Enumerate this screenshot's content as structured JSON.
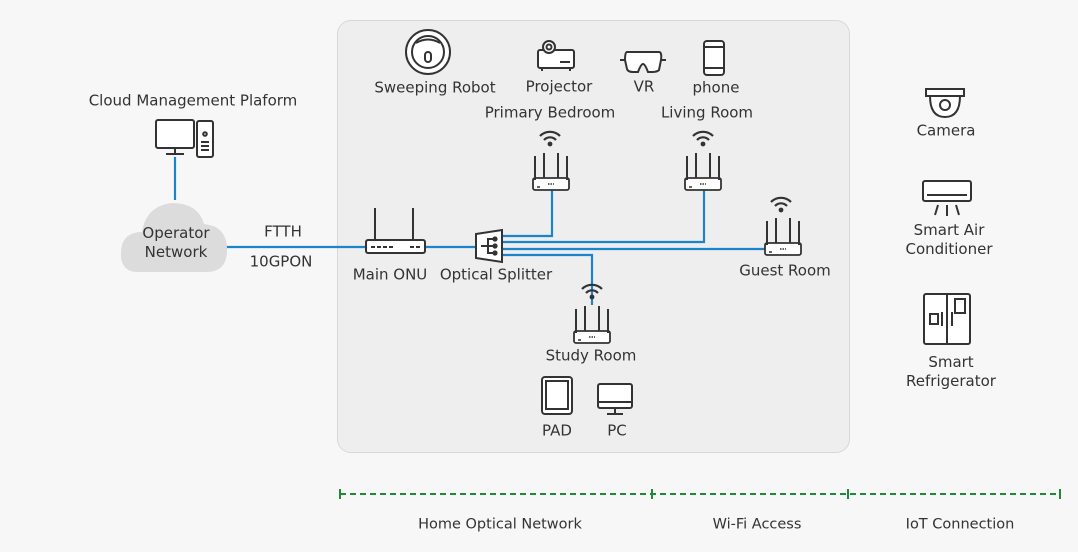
{
  "cloud_management": {
    "label": "Cloud Management Plaform"
  },
  "operator_network": {
    "label_line1": "Operator",
    "label_line2": "Network"
  },
  "link": {
    "type_label": "FTTH",
    "speed_label": "10GPON"
  },
  "home_devices": {
    "sweeping_robot": "Sweeping Robot",
    "projector": "Projector",
    "vr": "VR",
    "phone": "phone",
    "pad": "PAD",
    "pc": "PC"
  },
  "rooms": {
    "primary_bedroom": "Primary Bedroom",
    "living_room": "Living Room",
    "guest_room": "Guest Room",
    "study_room": "Study Room"
  },
  "core": {
    "main_onu": "Main ONU",
    "optical_splitter": "Optical Splitter"
  },
  "iot_devices": {
    "camera": "Camera",
    "air_conditioner_line1": "Smart Air",
    "air_conditioner_line2": "Conditioner",
    "refrigerator_line1": "Smart",
    "refrigerator_line2": "Refrigerator"
  },
  "sections": [
    "Home Optical Network",
    "Wi-Fi Access",
    "IoT Connection"
  ],
  "colors": {
    "fiber_line": "#1a85c8",
    "section_divider": "#1e8a3a",
    "panel": "#eeeeee",
    "cloud": "#dcdcdc",
    "icon_stroke": "#333333"
  }
}
